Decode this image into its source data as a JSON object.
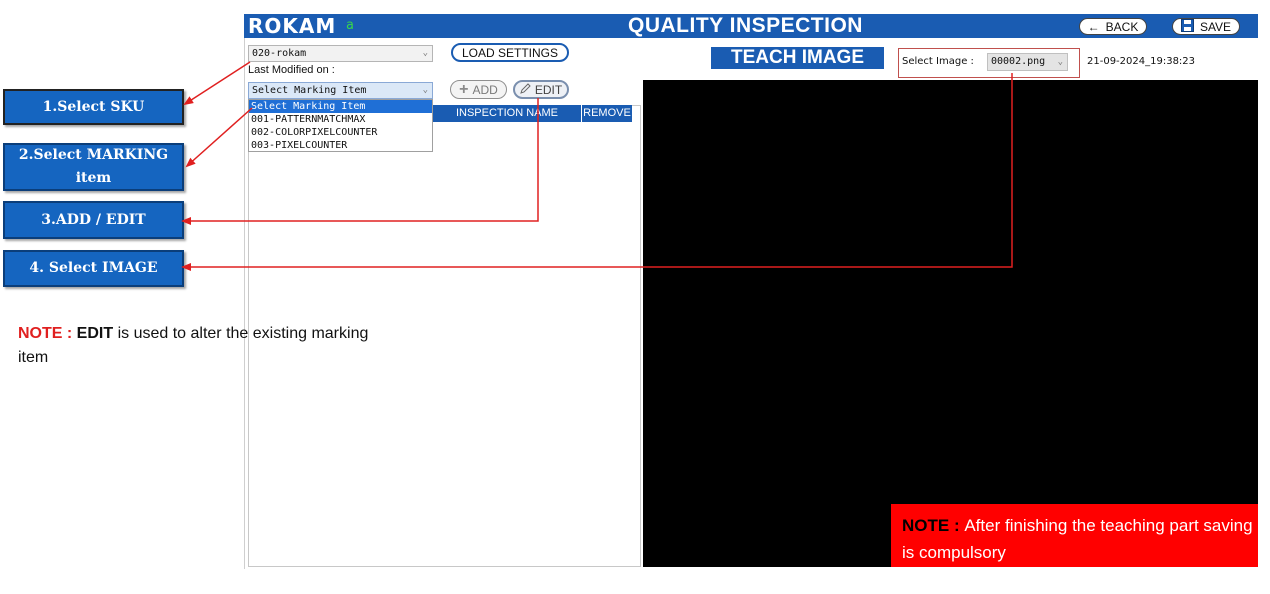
{
  "header": {
    "brand": "ROKAM",
    "brand_sub": "a",
    "title": "QUALITY INSPECTION",
    "back_label": "BACK",
    "save_label": "SAVE"
  },
  "left_panel": {
    "sku_value": "020-rokam",
    "last_modified_label": "Last Modified on :",
    "load_settings_label": "LOAD SETTINGS",
    "marking_select_value": "Select Marking Item",
    "marking_options": [
      "Select Marking Item",
      "001-PATTERNMATCHMAX",
      "002-COLORPIXELCOUNTER",
      "003-PIXELCOUNTER"
    ],
    "add_label": "ADD",
    "edit_label": "EDIT",
    "table_headers": [
      "INSPECTION NAME",
      "REMOVE"
    ]
  },
  "right_panel": {
    "section_title": "TEACH IMAGE",
    "select_image_label": "Select Image :",
    "select_image_value": "00002.png",
    "timestamp": "21-09-2024_19:38:23"
  },
  "annotations": {
    "steps": [
      "1.Select  SKU",
      "2.Select MARKING item",
      "3.ADD / EDIT",
      "4. Select IMAGE"
    ],
    "note_left_prefix": "NOTE : ",
    "note_left_bold": "EDIT",
    "note_left_text": " is used to alter the existing marking item",
    "note_right_prefix": "NOTE : ",
    "note_right_text": "After finishing the teaching part saving is compulsory"
  },
  "colors": {
    "brand_blue": "#1a5cb2",
    "callout_blue": "#1565c0",
    "arrow_red": "#e02020",
    "note_red": "#ff0000",
    "canvas": "#000000"
  }
}
